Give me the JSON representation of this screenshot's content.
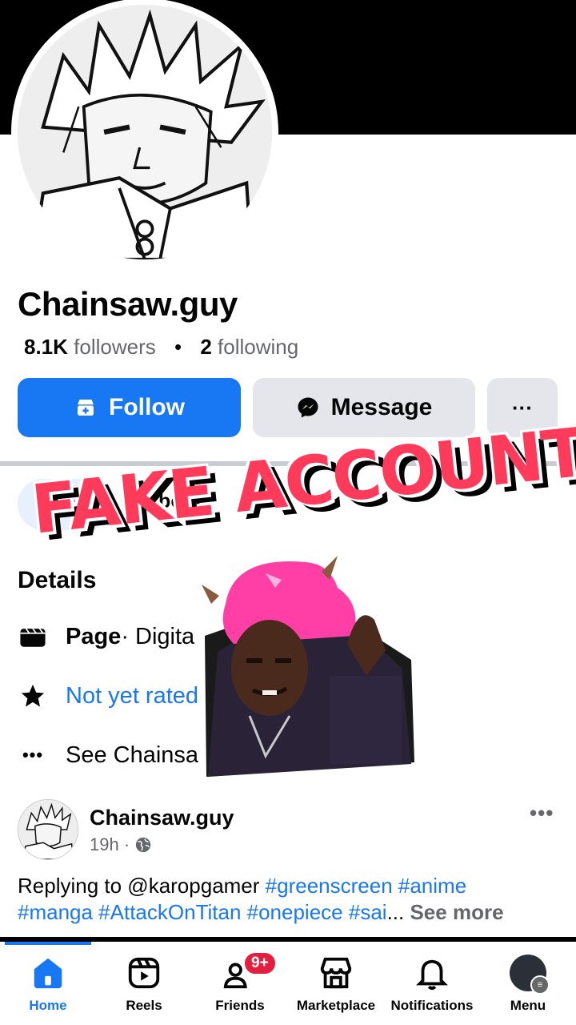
{
  "profile": {
    "name": "Chainsaw.guy",
    "followers_count": "8.1K",
    "followers_label": "followers",
    "following_count": "2",
    "following_label": "following"
  },
  "actions": {
    "follow_label": "Follow",
    "message_label": "Message",
    "more_label": "···"
  },
  "tabs": [
    {
      "label": "Posts",
      "active": true
    },
    {
      "label": "About",
      "active": false
    }
  ],
  "details": {
    "title": "Details",
    "page_bold": "Page",
    "page_text": " · Digita",
    "rated_text": "Not yet rated (0 reviews)",
    "see_text": "See Chainsa"
  },
  "overlay": {
    "caption": "FAKE ACCOUNT"
  },
  "post": {
    "author": "Chainsaw.guy",
    "time": "19h ·",
    "more_label": "•••",
    "reply_prefix": "Replying to @karopgamer ",
    "tags_line1": "#greenscreen #anime",
    "tags_line2": "#manga #AttackOnTitan #onepiece #sai",
    "ellipsis": "... ",
    "see_more": "See more"
  },
  "nav": {
    "items": [
      {
        "label": "Home",
        "icon": "home-icon",
        "active": true
      },
      {
        "label": "Reels",
        "icon": "reels-icon",
        "active": false
      },
      {
        "label": "Friends",
        "icon": "friends-icon",
        "active": false,
        "badge": "9+"
      },
      {
        "label": "Marketplace",
        "icon": "marketplace-icon",
        "active": false
      },
      {
        "label": "Notifications",
        "icon": "bell-icon",
        "active": false
      },
      {
        "label": "Menu",
        "icon": "avatar-menu-icon",
        "active": false
      }
    ]
  },
  "colors": {
    "accent": "#1877f2",
    "overlay_text": "#ff3b5c",
    "badge": "#e41e3f"
  }
}
